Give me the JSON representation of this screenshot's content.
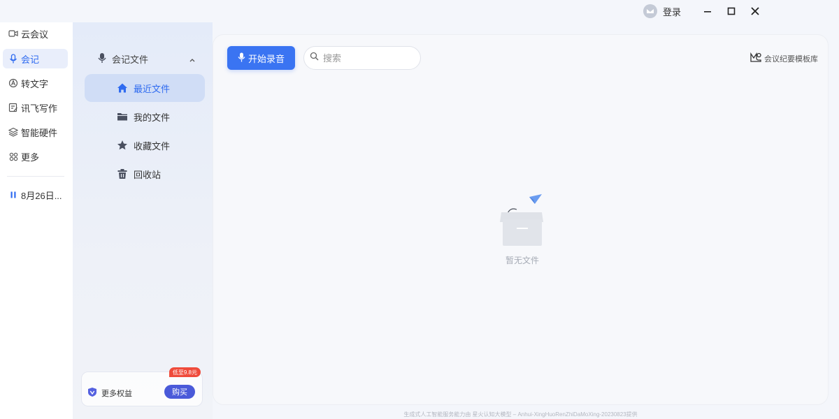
{
  "window": {
    "login_label": "登录"
  },
  "left_nav": {
    "items": [
      {
        "label": "云会议",
        "icon": "video-camera-icon"
      },
      {
        "label": "会记",
        "icon": "microphone-icon"
      },
      {
        "label": "转文字",
        "icon": "text-convert-icon"
      },
      {
        "label": "讯飞写作",
        "icon": "edit-document-icon"
      },
      {
        "label": "智能硬件",
        "icon": "layers-icon"
      },
      {
        "label": "更多",
        "icon": "apps-grid-icon"
      }
    ],
    "recording_item": "8月26日..."
  },
  "panel": {
    "header": "会记文件",
    "items": [
      {
        "label": "最近文件",
        "icon": "home-icon"
      },
      {
        "label": "我的文件",
        "icon": "folder-icon"
      },
      {
        "label": "收藏文件",
        "icon": "star-icon"
      },
      {
        "label": "回收站",
        "icon": "trash-icon"
      }
    ],
    "promo": {
      "label": "更多权益",
      "buy_label": "购买",
      "badge": "低至9.8元"
    }
  },
  "main": {
    "record_button": "开始录音",
    "search_placeholder": "搜索",
    "templates_label": "会议纪要模板库",
    "empty_text": "暂无文件"
  },
  "footer": "生成式人工智能服务能力由 星火认知大模型 – Anhui-XingHuoRenZhiDaMoXing-20230823提供",
  "colors": {
    "accent": "#3a74f2",
    "active_bg": "#d0ddf6",
    "badge": "#ef4b3b",
    "buy": "#4a5ad9"
  }
}
